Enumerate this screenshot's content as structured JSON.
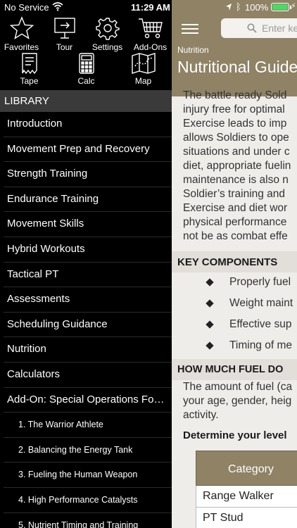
{
  "status_bar": {
    "carrier": "No Service",
    "time": "11:29 AM",
    "battery_percent": "100%",
    "battery_level": 1.0
  },
  "toolbar": {
    "row1": [
      {
        "label": "Favorites",
        "icon": "star-icon"
      },
      {
        "label": "Tour",
        "icon": "tour-icon"
      },
      {
        "label": "Settings",
        "icon": "gear-icon"
      },
      {
        "label": "Add-Ons",
        "icon": "cart-icon"
      }
    ],
    "row2": [
      {
        "label": "Tape",
        "icon": "tape-icon"
      },
      {
        "label": "Calc",
        "icon": "calculator-icon"
      },
      {
        "label": "Map",
        "icon": "map-icon"
      }
    ]
  },
  "library": {
    "header": "LIBRARY",
    "items": [
      "Introduction",
      "Movement Prep and Recovery",
      "Strength Training",
      "Endurance Training",
      "Movement Skills",
      "Hybrid Workouts",
      "Tactical PT",
      "Assessments",
      "Scheduling Guidance",
      "Nutrition",
      "Calculators",
      "Add-On: Special Operations For…"
    ],
    "sub_items": [
      "1. The Warrior Athlete",
      "2. Balancing the Energy Tank",
      "3. Fueling the Human Weapon",
      "4. High Performance Catalysts",
      "5. Nutrient Timing and Training"
    ]
  },
  "search": {
    "placeholder": "Enter ke"
  },
  "content": {
    "breadcrumb": "Nutrition",
    "title": "Nutritional Guide",
    "intro_lines": [
      "The battle ready Sold",
      "injury free for optimal",
      "Exercise leads to imp",
      "allows Soldiers to ope",
      "situations and under c",
      "diet, appropriate fuelin",
      "maintenance is also n",
      "Soldier’s training and",
      "Exercise and diet wor",
      "physical performance",
      "not be as combat effe"
    ],
    "key_components_header": "KEY COMPONENTS",
    "key_components": [
      "Properly fuel",
      "Weight maint",
      "Effective sup",
      "Timing of me"
    ],
    "fuel_header": "HOW MUCH FUEL DO",
    "fuel_lines": [
      "The amount of fuel (ca",
      "your age, gender, heig",
      "activity."
    ],
    "determine": "Determine your level",
    "table": {
      "header": "Category",
      "rows": [
        "Range Walker",
        "PT Stud"
      ]
    }
  },
  "colors": {
    "brand": "#8f8265",
    "sidebar_bg": "#000000",
    "content_bg": "#efedea",
    "battery_fill": "#4cd964"
  }
}
